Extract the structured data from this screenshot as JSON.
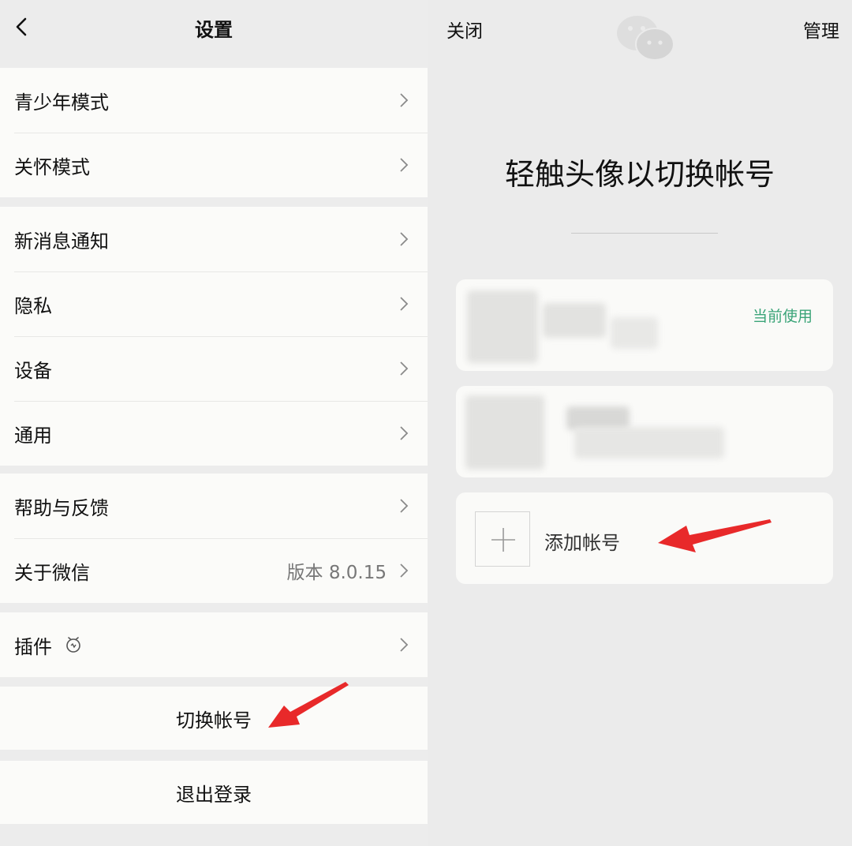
{
  "settings": {
    "title": "设置",
    "groups": [
      {
        "items": [
          {
            "label": "青少年模式"
          },
          {
            "label": "关怀模式"
          }
        ]
      },
      {
        "items": [
          {
            "label": "新消息通知"
          },
          {
            "label": "隐私"
          },
          {
            "label": "设备"
          },
          {
            "label": "通用"
          }
        ]
      },
      {
        "items": [
          {
            "label": "帮助与反馈"
          },
          {
            "label": "关于微信",
            "value": "版本 8.0.15"
          }
        ]
      },
      {
        "items": [
          {
            "label": "插件"
          }
        ]
      }
    ],
    "switch_account_label": "切换帐号",
    "logout_label": "退出登录"
  },
  "account_switch": {
    "close_label": "关闭",
    "manage_label": "管理",
    "heading": "轻触头像以切换帐号",
    "current_tag": "当前使用",
    "add_account_label": "添加帐号"
  },
  "colors": {
    "accent_green": "#3aa478",
    "annotation_arrow": "#e8292a"
  },
  "icons": [
    "back-chevron-icon",
    "chevron-right-icon",
    "plugin-icon",
    "wechat-logo-icon",
    "plus-icon",
    "annotation-arrow"
  ]
}
